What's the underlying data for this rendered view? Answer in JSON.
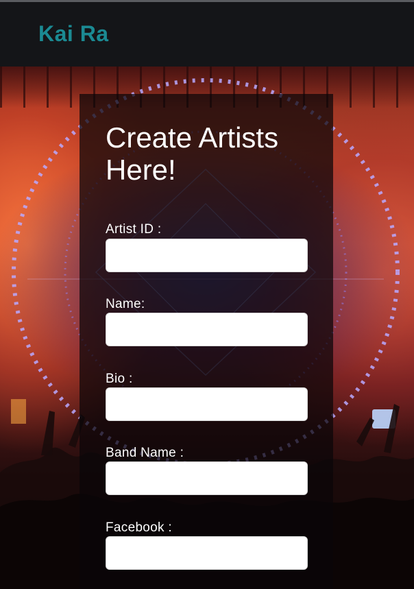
{
  "header": {
    "brand": "Kai Ra"
  },
  "colors": {
    "brand": "#1b8a93",
    "header_bg": "#141518"
  },
  "form": {
    "title": "Create Artists Here!",
    "fields": [
      {
        "label": "Artist ID :",
        "value": "",
        "placeholder": ""
      },
      {
        "label": "Name:",
        "value": "",
        "placeholder": ""
      },
      {
        "label": "Bio :",
        "value": "",
        "placeholder": ""
      },
      {
        "label": "Band Name :",
        "value": "",
        "placeholder": ""
      },
      {
        "label": "Facebook :",
        "value": "",
        "placeholder": ""
      }
    ]
  }
}
